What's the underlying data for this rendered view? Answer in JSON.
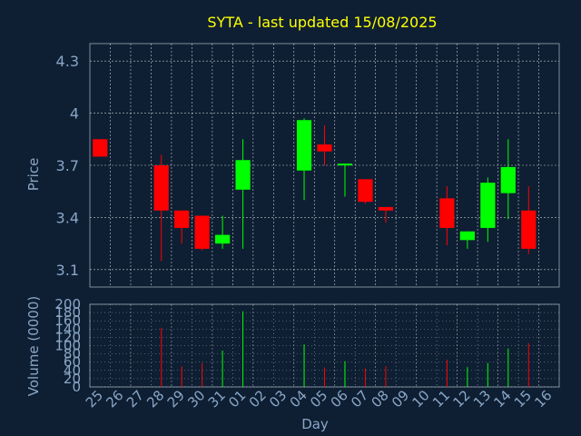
{
  "chart_data": [
    {
      "type": "candlestick",
      "title": "SYTA - last updated 15/08/2025",
      "ylabel": "Price",
      "xlabel": "",
      "ylim": [
        3.0,
        4.4
      ],
      "yticks": [
        "4.3",
        "4",
        "3.7",
        "3.4",
        "3.1"
      ],
      "grid": true,
      "colors": {
        "up": "#00ff00",
        "down": "#ff0000",
        "title": "#ffff00",
        "axis_text": "#8aa6c6",
        "grid": "#ffffff"
      },
      "candles": [
        {
          "day": "25",
          "open": 3.85,
          "high": 3.85,
          "low": 3.75,
          "close": 3.75
        },
        {
          "day": "28",
          "open": 3.7,
          "high": 3.76,
          "low": 3.15,
          "close": 3.44
        },
        {
          "day": "29",
          "open": 3.44,
          "high": 3.44,
          "low": 3.25,
          "close": 3.34
        },
        {
          "day": "30",
          "open": 3.41,
          "high": 3.41,
          "low": 3.21,
          "close": 3.22
        },
        {
          "day": "31",
          "open": 3.25,
          "high": 3.41,
          "low": 3.22,
          "close": 3.3
        },
        {
          "day": "01",
          "open": 3.56,
          "high": 3.85,
          "low": 3.22,
          "close": 3.73
        },
        {
          "day": "04",
          "open": 3.67,
          "high": 3.97,
          "low": 3.5,
          "close": 3.96
        },
        {
          "day": "05",
          "open": 3.82,
          "high": 3.93,
          "low": 3.7,
          "close": 3.78
        },
        {
          "day": "06",
          "open": 3.7,
          "high": 3.71,
          "low": 3.52,
          "close": 3.71
        },
        {
          "day": "07",
          "open": 3.62,
          "high": 3.62,
          "low": 3.48,
          "close": 3.49
        },
        {
          "day": "08",
          "open": 3.46,
          "high": 3.46,
          "low": 3.37,
          "close": 3.44
        },
        {
          "day": "11",
          "open": 3.51,
          "high": 3.58,
          "low": 3.24,
          "close": 3.34
        },
        {
          "day": "12",
          "open": 3.27,
          "high": 3.32,
          "low": 3.22,
          "close": 3.32
        },
        {
          "day": "13",
          "open": 3.34,
          "high": 3.63,
          "low": 3.26,
          "close": 3.6
        },
        {
          "day": "14",
          "open": 3.54,
          "high": 3.85,
          "low": 3.39,
          "close": 3.69
        },
        {
          "day": "15",
          "open": 3.44,
          "high": 3.58,
          "low": 3.19,
          "close": 3.22
        }
      ]
    },
    {
      "type": "bar",
      "ylabel": "Volume (0000)",
      "xlabel": "Day",
      "ylim": [
        0,
        200
      ],
      "yticks": [
        "200",
        "180",
        "160",
        "140",
        "120",
        "100",
        "80",
        "60",
        "40",
        "20",
        "0"
      ],
      "categories": [
        "25",
        "26",
        "27",
        "28",
        "29",
        "30",
        "31",
        "01",
        "02",
        "03",
        "04",
        "05",
        "06",
        "07",
        "08",
        "09",
        "10",
        "11",
        "12",
        "13",
        "14",
        "15",
        "16"
      ],
      "bars": [
        {
          "day": "28",
          "value": 143,
          "direction": "down"
        },
        {
          "day": "29",
          "value": 50,
          "direction": "down"
        },
        {
          "day": "30",
          "value": 58,
          "direction": "down"
        },
        {
          "day": "31",
          "value": 88,
          "direction": "up"
        },
        {
          "day": "01",
          "value": 183,
          "direction": "up"
        },
        {
          "day": "04",
          "value": 103,
          "direction": "up"
        },
        {
          "day": "05",
          "value": 47,
          "direction": "down"
        },
        {
          "day": "06",
          "value": 62,
          "direction": "up"
        },
        {
          "day": "07",
          "value": 45,
          "direction": "down"
        },
        {
          "day": "08",
          "value": 50,
          "direction": "down"
        },
        {
          "day": "11",
          "value": 66,
          "direction": "down"
        },
        {
          "day": "12",
          "value": 48,
          "direction": "up"
        },
        {
          "day": "13",
          "value": 58,
          "direction": "up"
        },
        {
          "day": "14",
          "value": 93,
          "direction": "up"
        },
        {
          "day": "15",
          "value": 106,
          "direction": "down"
        }
      ]
    }
  ]
}
